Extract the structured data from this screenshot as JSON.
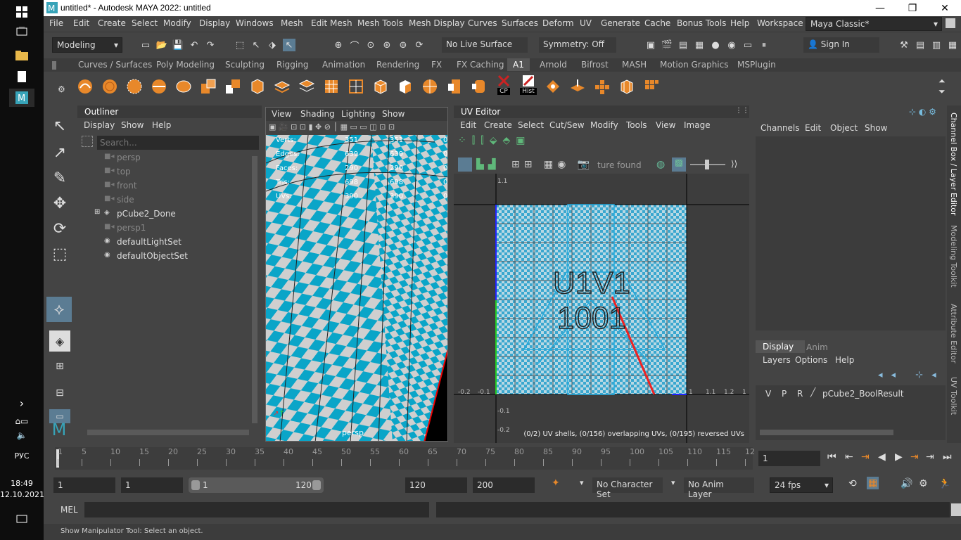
{
  "taskbar": {
    "lang": "РУС",
    "time": "18:49",
    "date": "12.10.2021"
  },
  "window": {
    "title": "untitled* - Autodesk MAYA 2022: untitled",
    "minimize": "—",
    "restore": "❐",
    "close": "✕"
  },
  "menus": [
    "File",
    "Edit",
    "Create",
    "Select",
    "Modify",
    "Display",
    "Windows",
    "Mesh",
    "Edit Mesh",
    "Mesh Tools",
    "Mesh Display",
    "Curves",
    "Surfaces",
    "Deform",
    "UV",
    "Generate",
    "Cache",
    "Bonus Tools",
    "Help"
  ],
  "workspace": {
    "label": "Workspace :",
    "value": "Maya Classic*"
  },
  "status": {
    "menuset": "Modeling",
    "live_surface": "No Live Surface",
    "symmetry": "Symmetry: Off",
    "sign_in": "Sign In"
  },
  "shelf_tabs": [
    "Curves / Surfaces",
    "Poly Modeling",
    "Sculpting",
    "Rigging",
    "Animation",
    "Rendering",
    "FX",
    "FX Caching",
    "A1",
    "Arnold",
    "Bifrost",
    "MASH",
    "Motion Graphics",
    "MSPlugin"
  ],
  "shelf_labels": {
    "cp": "CP",
    "hist": "Hist"
  },
  "outliner": {
    "title": "Outliner",
    "menu": [
      "Display",
      "Show",
      "Help"
    ],
    "search_placeholder": "Search...",
    "items": [
      {
        "label": "persp",
        "dim": true
      },
      {
        "label": "top",
        "dim": true
      },
      {
        "label": "front",
        "dim": true
      },
      {
        "label": "side",
        "dim": true
      },
      {
        "label": "pCube2_Done",
        "dim": false
      },
      {
        "label": "persp1",
        "dim": true
      },
      {
        "label": "defaultLightSet",
        "dim": false
      },
      {
        "label": "defaultObjectSet",
        "dim": false
      }
    ]
  },
  "viewport": {
    "menu": [
      "View",
      "Shading",
      "Lighting",
      "Show"
    ],
    "camera": "persp",
    "stats": [
      {
        "label": "Verts:",
        "a": "351",
        "b": "351",
        "c": "0"
      },
      {
        "label": "Edges:",
        "a": "639",
        "b": "639",
        "c": "0"
      },
      {
        "label": "Faces:",
        "a": "290",
        "b": "290",
        "c": "0"
      },
      {
        "label": "Tris:",
        "a": "698",
        "b": "698",
        "c": "0"
      },
      {
        "label": "UVs:",
        "a": "390",
        "b": "390",
        "c": "0"
      }
    ]
  },
  "uv_editor": {
    "title": "UV Editor",
    "menu": [
      "Edit",
      "Create",
      "Select",
      "Cut/Sew",
      "Modify",
      "Tools",
      "View",
      "Image"
    ],
    "texture_field": "ture found",
    "tile_label_1": "U1V1",
    "tile_label_2": "1001",
    "status": "(0/2) UV shells, (0/156) overlapping UVs, (0/195) reversed UVs",
    "ticks_x": [
      "-0.2",
      "-0.1",
      "1",
      "1.1",
      "1.2",
      "1"
    ],
    "ticks_y": [
      "1.1",
      "-0.1",
      "-0.2"
    ]
  },
  "channel_box": {
    "menu": [
      "Channels",
      "Edit",
      "Object",
      "Show"
    ],
    "tabs": [
      "Display",
      "Anim"
    ],
    "layer_menu": [
      "Layers",
      "Options",
      "Help"
    ],
    "layer": {
      "v": "V",
      "p": "P",
      "r": "R",
      "name": "pCube2_BoolResult"
    }
  },
  "side_tabs": [
    "Channel Box / Layer Editor",
    "Modeling Toolkit",
    "Attribute Editor",
    "UV Toolkit"
  ],
  "timeline": {
    "ticks": [
      "1",
      "5",
      "10",
      "15",
      "20",
      "25",
      "30",
      "35",
      "40",
      "45",
      "50",
      "55",
      "60",
      "65",
      "70",
      "75",
      "80",
      "85",
      "90",
      "95",
      "100",
      "105",
      "110",
      "115",
      "12"
    ],
    "current_frame": "1"
  },
  "range": {
    "start": "1",
    "anim_start": "1",
    "slider_start": "1",
    "slider_end": "120",
    "end": "120",
    "anim_end": "200",
    "character": "No Character Set",
    "anim_layer": "No Anim Layer",
    "fps": "24 fps"
  },
  "cmd": {
    "label": "MEL"
  },
  "help_line": "Show Manipulator Tool: Select an object."
}
